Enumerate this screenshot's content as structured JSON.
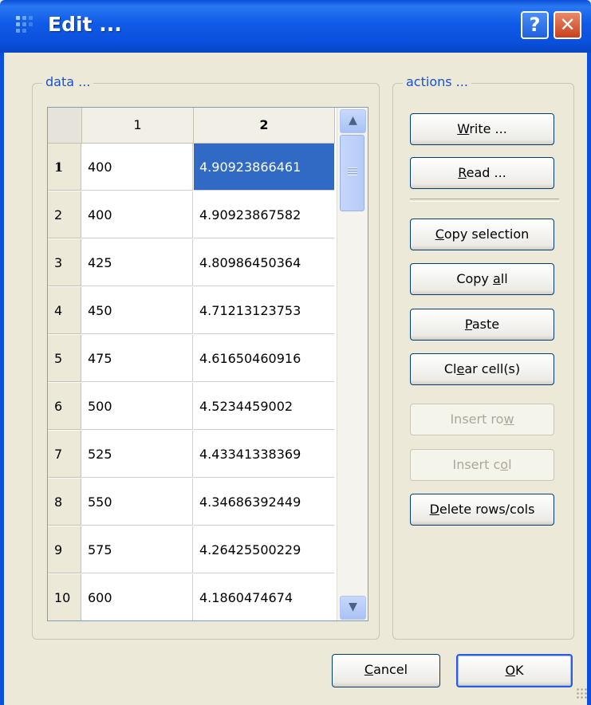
{
  "window": {
    "title": "Edit ...",
    "help_glyph": "?",
    "close_glyph": "✕"
  },
  "groups": {
    "data_label": "data ...",
    "actions_label": "actions ..."
  },
  "table": {
    "columns": [
      "1",
      "2"
    ],
    "selected_cell": {
      "row": 1,
      "column": 2
    },
    "rows": [
      {
        "n": "1",
        "c1": "400",
        "c2": "4.90923866461"
      },
      {
        "n": "2",
        "c1": "400",
        "c2": "4.90923867582"
      },
      {
        "n": "3",
        "c1": "425",
        "c2": "4.80986450364"
      },
      {
        "n": "4",
        "c1": "450",
        "c2": "4.71213123753"
      },
      {
        "n": "5",
        "c1": "475",
        "c2": "4.61650460916"
      },
      {
        "n": "6",
        "c1": "500",
        "c2": "4.5234459002"
      },
      {
        "n": "7",
        "c1": "525",
        "c2": "4.43341338369"
      },
      {
        "n": "8",
        "c1": "550",
        "c2": "4.34686392449"
      },
      {
        "n": "9",
        "c1": "575",
        "c2": "4.26425500229"
      },
      {
        "n": "10",
        "c1": "600",
        "c2": "4.1860474674"
      }
    ]
  },
  "scrollbar": {
    "up_glyph": "▲",
    "down_glyph": "▼"
  },
  "actions": {
    "write": {
      "pre": "",
      "u": "W",
      "post": "rite ..."
    },
    "read": {
      "pre": "",
      "u": "R",
      "post": "ead ..."
    },
    "copy_selection": {
      "pre": "",
      "u": "C",
      "post": "opy selection"
    },
    "copy_all": {
      "pre": "Copy ",
      "u": "a",
      "post": "ll"
    },
    "paste": {
      "pre": "",
      "u": "P",
      "post": "aste"
    },
    "clear_cells": {
      "pre": "Cl",
      "u": "e",
      "post": "ar cell(s)"
    },
    "insert_row": {
      "pre": "Insert ro",
      "u": "w",
      "post": ""
    },
    "insert_col": {
      "pre": "Insert c",
      "u": "o",
      "post": "l"
    },
    "delete_rows_cols": {
      "pre": "",
      "u": "D",
      "post": "elete rows/cols"
    }
  },
  "footer": {
    "cancel": {
      "pre": "",
      "u": "C",
      "post": "ancel"
    },
    "ok": {
      "pre": "",
      "u": "O",
      "post": "K"
    }
  }
}
